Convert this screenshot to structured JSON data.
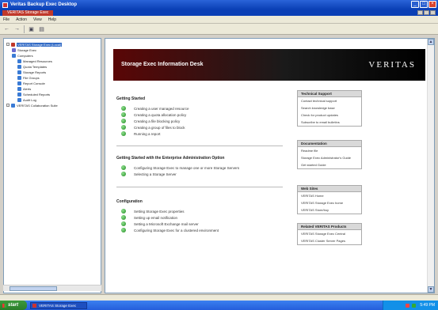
{
  "window": {
    "title": "Veritas Backup Exec Desktop",
    "doc_tab": "VERITAS Storage Exec"
  },
  "menu": [
    "File",
    "Action",
    "View",
    "Help"
  ],
  "tree": [
    {
      "label": "VERITAS Storage Exec (Local)",
      "level": 0,
      "selected": true,
      "color": "#c0392b"
    },
    {
      "label": "Storage Exec",
      "level": 1,
      "color": "#6a6ad0"
    },
    {
      "label": "Computers",
      "level": 1,
      "color": "#3a7bd5"
    },
    {
      "label": "Managed Resources",
      "level": 2,
      "color": "#3a7bd5"
    },
    {
      "label": "Quota Templates",
      "level": 2,
      "color": "#3a7bd5"
    },
    {
      "label": "Storage Reports",
      "level": 2,
      "color": "#3a7bd5"
    },
    {
      "label": "File Groups",
      "level": 2,
      "color": "#3a7bd5"
    },
    {
      "label": "Report Console",
      "level": 2,
      "color": "#3a7bd5"
    },
    {
      "label": "Alerts",
      "level": 2,
      "color": "#3a7bd5"
    },
    {
      "label": "Scheduled Reports",
      "level": 2,
      "color": "#3a7bd5"
    },
    {
      "label": "Audit Log",
      "level": 2,
      "color": "#3a7bd5"
    },
    {
      "label": "VERITAS Collaboration Suite",
      "level": 0,
      "color": "#3a7bd5"
    }
  ],
  "banner": {
    "title": "Storage Exec Information Desk",
    "logo": "VERITAS"
  },
  "sections": {
    "getting_started": {
      "title": "Getting Started",
      "tasks": [
        "Creating a user managed resource",
        "Creating a quota allocation policy",
        "Creating a file blocking policy",
        "Creating a group of files to block",
        "Running a report"
      ]
    },
    "getting_started_enterprise": {
      "title": "Getting Started with the Enterprise Administration Option",
      "tasks": [
        "Configuring Storage Exec to manage one or more Storage Servers",
        "Selecting a Storage Server"
      ]
    },
    "configuration": {
      "title": "Configuration",
      "tasks": [
        "Setting Storage Exec properties",
        "Setting up email notification",
        "Setting a Microsoft Exchange mail server",
        "Configuring Storage Exec for a clustered environment"
      ]
    }
  },
  "side_panels": [
    {
      "title": "Technical Support",
      "links": [
        "Contact technical support",
        "Search knowledge base",
        "Check for product updates",
        "Subscribe to email bulletins"
      ]
    },
    {
      "title": "Documentation",
      "links": [
        "Readme file",
        "Storage Exec Administrator's Guide",
        "Get started Guide"
      ]
    },
    {
      "title": "Web Sites",
      "links": [
        "VERITAS Home",
        "VERITAS Storage Exec home",
        "VERITAS Store/buy"
      ]
    },
    {
      "title": "Related VERITAS Products",
      "links": [
        "VERITAS Storage Exec Central",
        "VERITAS Cluster Server Pages"
      ]
    }
  ],
  "taskbar": {
    "start": "start",
    "task": "VERITAS Storage Exec",
    "clock": "5:49 PM"
  },
  "colors": {
    "task_icon": "#2a9a2a",
    "banner_dark": "#000000",
    "selection": "#316ac5"
  }
}
